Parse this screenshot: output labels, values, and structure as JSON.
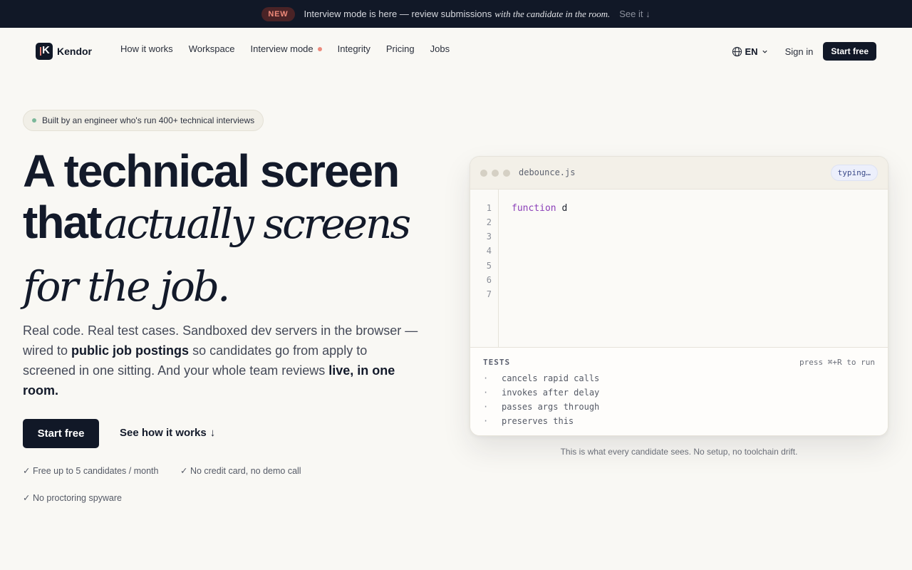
{
  "announcement": {
    "badge": "NEW",
    "text": "Interview mode is here — review submissions",
    "italic": "with the candidate in the room.",
    "link": "See it ↓"
  },
  "nav": {
    "brand": "Kendor",
    "logo_letter": "K",
    "menu": [
      "How it works",
      "Workspace",
      "Interview mode",
      "Integrity",
      "Pricing",
      "Jobs"
    ],
    "lang": "EN",
    "signin": "Sign in",
    "start": "Start free"
  },
  "hero": {
    "pill": "Built by an engineer who's run 400+ technical interviews",
    "headline_line1": "A technical screen",
    "headline_line2_sans": "that",
    "headline_line2_serif": "actually screens",
    "headline_line3": "for the job.",
    "lead_part1": "Real code. Real test cases. Sandboxed dev servers in the browser — wired to",
    "lead_bold1": "public job postings",
    "lead_part2": "so candidates go from apply to screened in one sitting. And your whole team reviews",
    "lead_bold2": "live, in one room.",
    "cta_primary": "Start free",
    "cta_secondary": "See how it works",
    "cta_secondary_arrow": "↓",
    "checks": [
      "✓ Free up to 5 candidates / month",
      "✓ No credit card, no demo call",
      "✓ No proctoring spyware"
    ]
  },
  "editor": {
    "filename": "debounce.js",
    "status": "typing…",
    "line_numbers": [
      "1",
      "2",
      "3",
      "4",
      "5",
      "6",
      "7"
    ],
    "code_keyword": "function",
    "code_rest": " d",
    "tests_title": "TESTS",
    "tests_hint": "press ⌘+R to run",
    "tests": [
      "cancels rapid calls",
      "invokes after delay",
      "passes args through",
      "preserves this"
    ],
    "bullet": "·",
    "caption": "This is what every candidate sees. No setup, no toolchain drift."
  }
}
